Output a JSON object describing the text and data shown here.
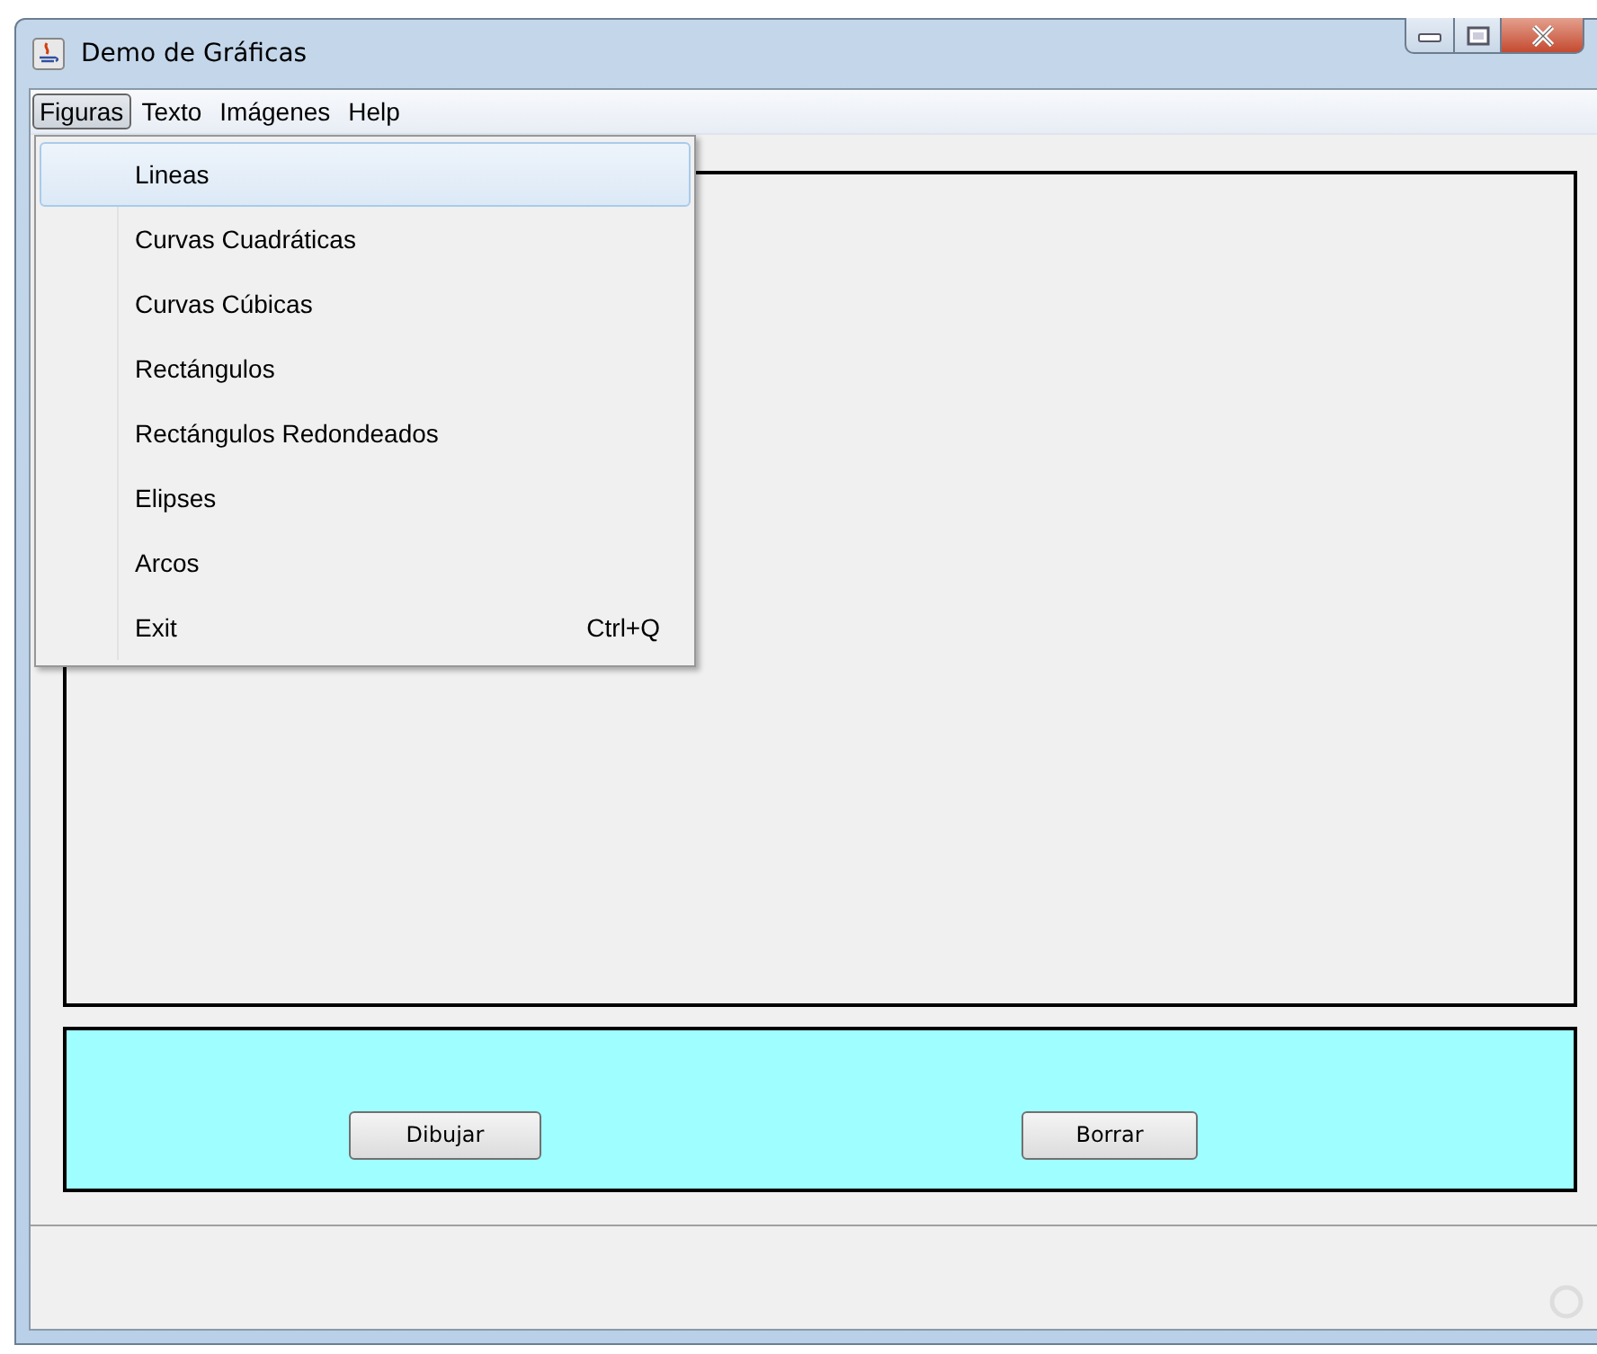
{
  "window": {
    "title": "Demo de Gráficas"
  },
  "menu_bar": [
    {
      "label": "Figuras",
      "selected": true
    },
    {
      "label": "Texto",
      "selected": false
    },
    {
      "label": "Imágenes",
      "selected": false
    },
    {
      "label": "Help",
      "selected": false
    }
  ],
  "dropdown": [
    {
      "label": "Lineas",
      "selected": true
    },
    {
      "label": "Curvas Cuadráticas",
      "selected": false
    },
    {
      "label": "Curvas Cúbicas",
      "selected": false
    },
    {
      "label": "Rectángulos",
      "selected": false
    },
    {
      "label": "Rectángulos Redondeados",
      "selected": false
    },
    {
      "label": "Elipses",
      "selected": false
    },
    {
      "label": "Arcos",
      "selected": false
    },
    {
      "label": "Exit",
      "selected": false,
      "shortcut": "Ctrl+Q"
    }
  ],
  "buttons": [
    "Dibujar",
    "Borrar"
  ]
}
